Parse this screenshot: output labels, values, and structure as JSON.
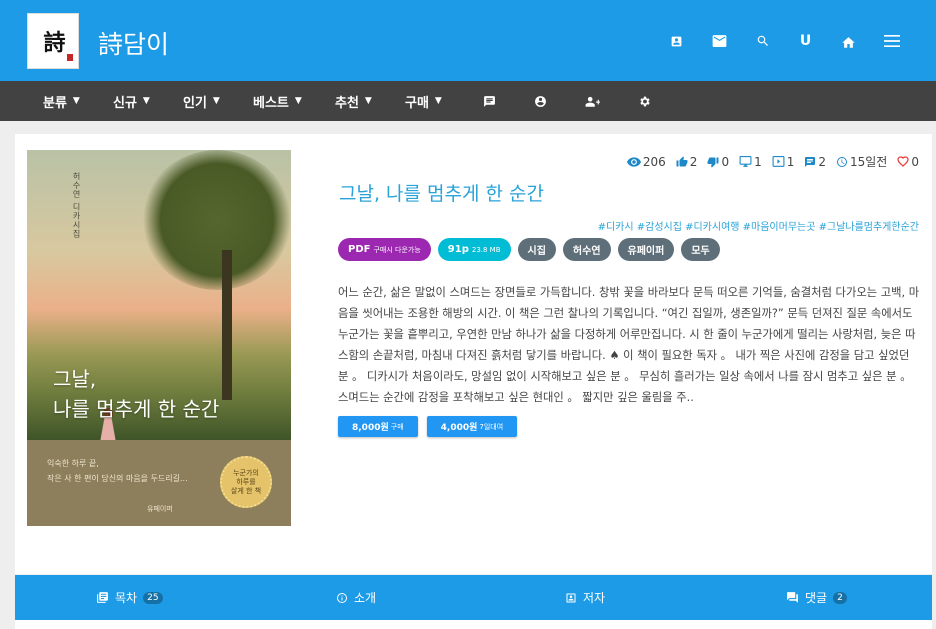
{
  "header": {
    "site_title": "詩담이",
    "logo_text": "詩",
    "icons": [
      "profile-card-icon",
      "mail-icon",
      "search-icon",
      "user-initial-icon",
      "home-icon",
      "menu-icon"
    ],
    "user_initial": "U"
  },
  "nav": {
    "items": [
      {
        "label": "분류"
      },
      {
        "label": "신규"
      },
      {
        "label": "인기"
      },
      {
        "label": "베스트"
      },
      {
        "label": "추천"
      },
      {
        "label": "구매"
      }
    ],
    "icons": [
      "message-icon",
      "account-circle-icon",
      "people-icon",
      "settings-icon"
    ]
  },
  "book": {
    "title": "그날, 나를 멈추게 한 순간",
    "cover": {
      "vertical_text": "허수연 디카시집",
      "title_line1": "그날,",
      "title_line2": "나를 멈추게 한 순간",
      "subtitle_line1": "익숙한 하루 끝,",
      "subtitle_line2": "작은 사 한 편이 당신의 마음을 두드리길...",
      "author": "유페이퍼",
      "badge_line1": "누군가의",
      "badge_line2": "하루를",
      "badge_line3": "살게 한 책"
    },
    "stats": {
      "views": "206",
      "likes": "2",
      "dislikes": "0",
      "screen": "1",
      "slides": "1",
      "comments": "2",
      "date": "15일전",
      "hearts": "0"
    },
    "hashtags": "#디카시 #감성시집 #디카시여행 #마음이머무는곳 #그날나를멈추게한순간",
    "chips": {
      "pdf": "PDF",
      "pdf_note": "구매시 다운가능",
      "pages": "91p",
      "size": "23.8 MB",
      "genre": "시집",
      "author": "허수연",
      "publisher": "유페이퍼",
      "audience": "모두"
    },
    "description": "어느 순간, 삶은 말없이 스며드는 장면들로 가득합니다. 창밖 꽃을 바라보다 문득 떠오른 기억들, 숨결처럼 다가오는 고백, 마음을 씻어내는 조용한 해방의 시간. 이 책은 그런 찰나의 기록입니다. “여긴 집일까, 생존일까?” 문득 던져진 질문 속에서도 누군가는 꽃을 흩뿌리고, 우연한 만남 하나가 삶을 다정하게 어루만집니다. 시 한 줄이 누군가에게 떨리는 사랑처럼, 늦은 따스함의 손끝처럼, 마침내 다져진 흙처럼 닿기를 바랍니다. ♠ 이 책이 필요한 독자 。 내가 찍은 사진에 감정을 담고 싶었던 분 。 디카시가 처음이라도, 망설임 없이 시작해보고 싶은 분 。 무심히 흘러가는 일상 속에서 나를 잠시 멈추고 싶은 분 。 스며드는 순간에 감정을 포착해보고 싶은 현대인 。 짧지만 깊은 울림을 주..",
    "buy_buttons": [
      {
        "price": "8,000원",
        "note": "구매"
      },
      {
        "price": "4,000원",
        "note": "7일대여"
      }
    ]
  },
  "tabs": [
    {
      "label": "목차",
      "count": "25",
      "icon": "library-books-icon"
    },
    {
      "label": "소개",
      "count": "",
      "icon": "info-icon"
    },
    {
      "label": "저자",
      "count": "",
      "icon": "contact-card-icon"
    },
    {
      "label": "댓글",
      "count": "2",
      "icon": "forum-icon"
    }
  ],
  "colors": {
    "primary": "#1e9be6",
    "navbar": "#424242",
    "title": "#29a3d8",
    "pdf_chip": "#9c27b0",
    "pages_chip": "#00bcd4",
    "gray_chip": "#5f6f7a",
    "buy_button": "#2196f3"
  }
}
